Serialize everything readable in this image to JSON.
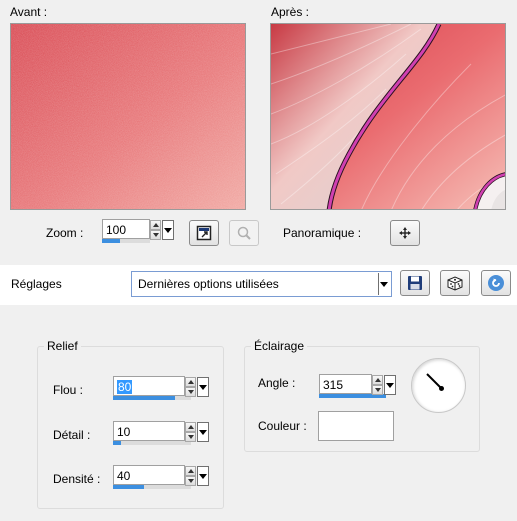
{
  "before_label": "Avant :",
  "after_label": "Après :",
  "zoom": {
    "label": "Zoom :",
    "value": "100",
    "fill": 0.38
  },
  "pan_label": "Panoramique :",
  "settings": {
    "label": "Réglages",
    "preset": "Dernières options utilisées"
  },
  "relief": {
    "title": "Relief",
    "flou": {
      "label": "Flou :",
      "value": "80",
      "fill": 0.8
    },
    "detail": {
      "label": "Détail :",
      "value": "10",
      "fill": 0.1
    },
    "densite": {
      "label": "Densité :",
      "value": "40",
      "fill": 0.4
    }
  },
  "eclairage": {
    "title": "Éclairage",
    "angle": {
      "label": "Angle :",
      "value": "315",
      "fill": 0.88
    },
    "couleur_label": "Couleur :"
  },
  "colors": {
    "accent": "#3c8fe0",
    "preview_base": "#e8787a",
    "magenta_line": "#d040b0",
    "light_color": "#ffffff"
  },
  "icons": {
    "zoom_fit": "fit-window-icon",
    "zoom_magnify": "magnify-icon",
    "pan": "move-icon",
    "save": "save-icon",
    "random": "dice-icon",
    "reset": "reset-icon"
  }
}
